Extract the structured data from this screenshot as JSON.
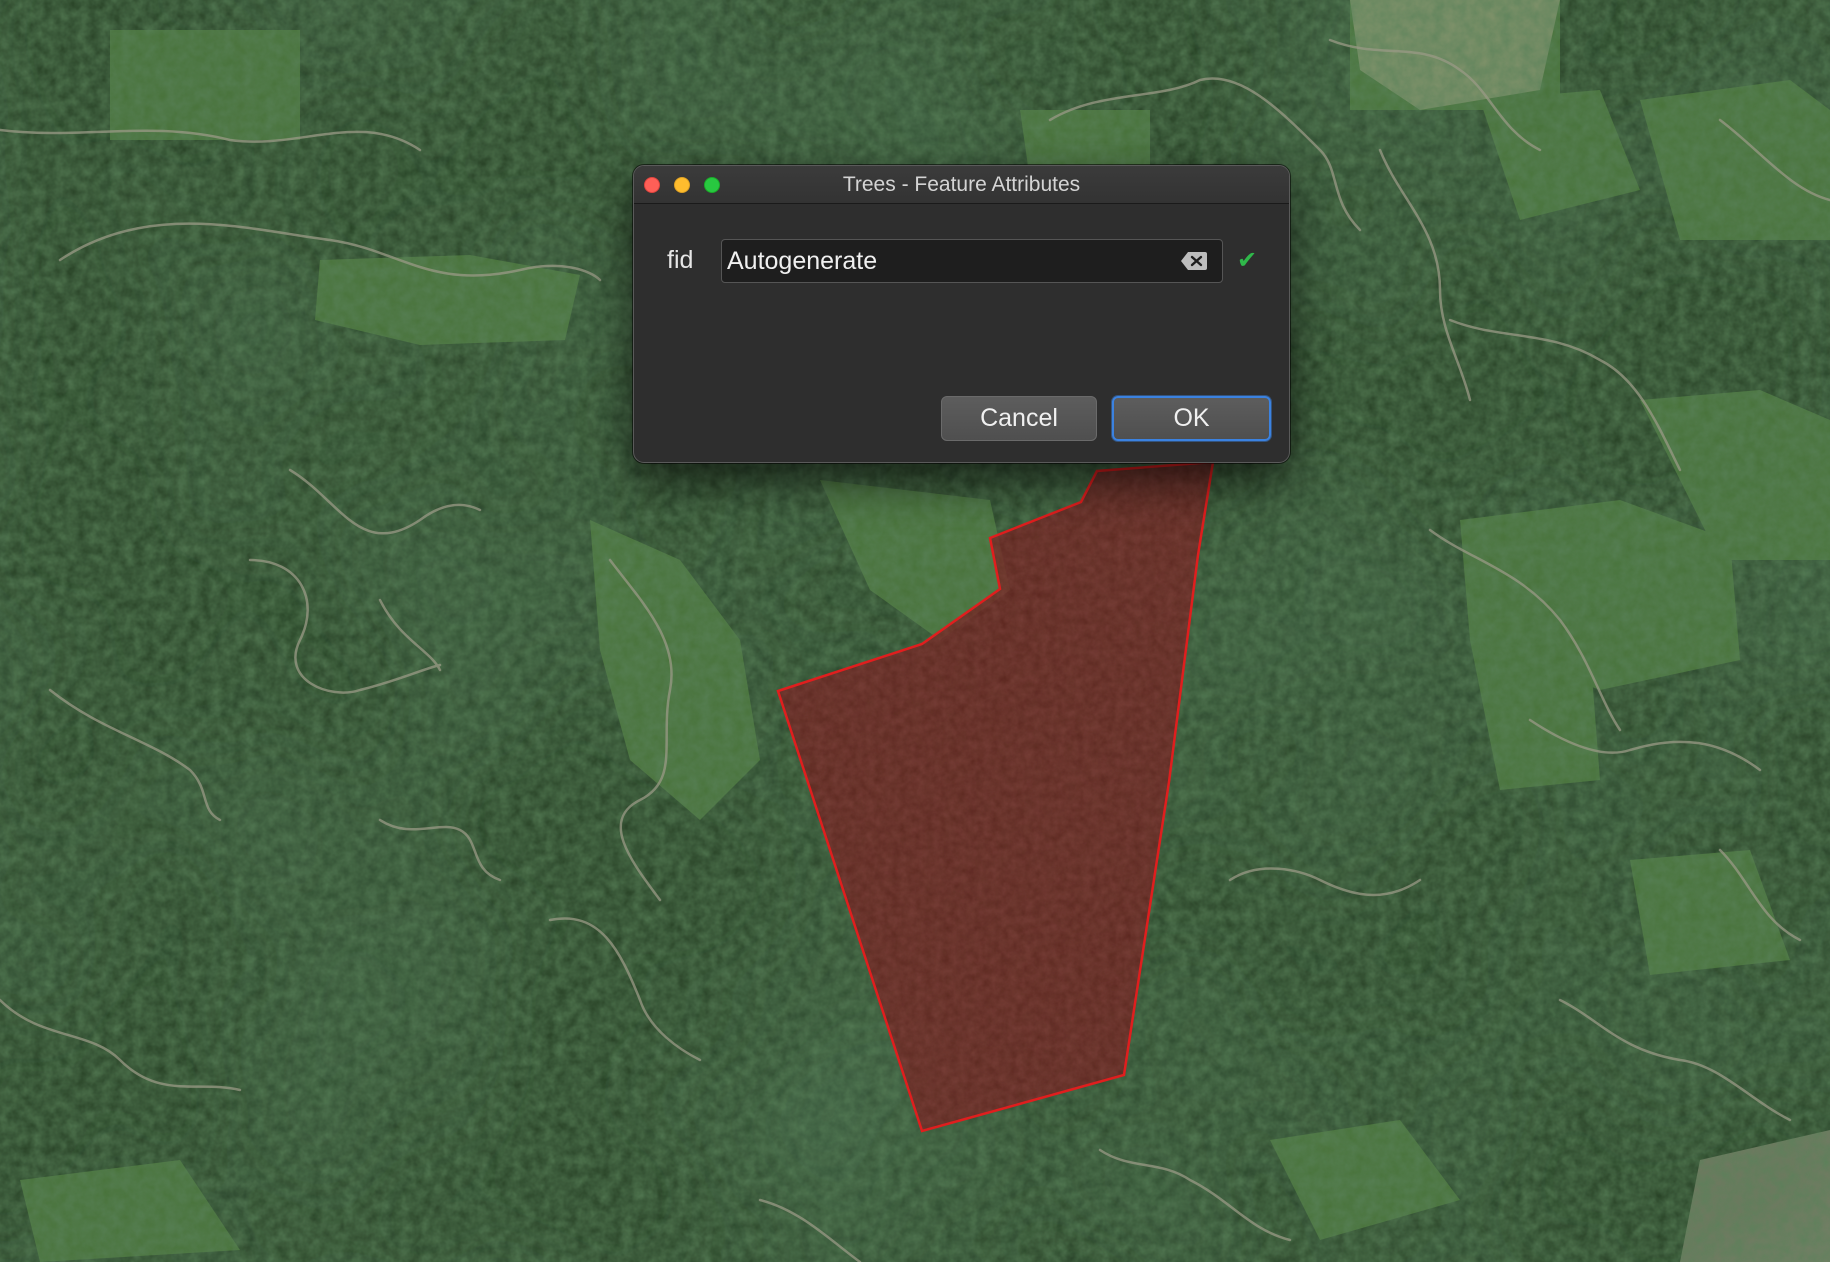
{
  "dialog": {
    "title": "Trees - Feature Attributes",
    "field_label": "fid",
    "field_value": "Autogenerate",
    "cancel_label": "Cancel",
    "ok_label": "OK"
  },
  "map": {
    "polygon_stroke_color": "#e01e1e",
    "polygon_fill_color": "#6a1616"
  },
  "icons": {
    "clear": "clear-field-icon",
    "valid": "checkmark-icon",
    "window_controls": [
      "close-icon",
      "minimize-icon",
      "maximize-icon"
    ]
  },
  "colors": {
    "dialog_background": "#2e2e2e",
    "accent": "#3b82e0",
    "valid_check": "#2fb84a"
  }
}
